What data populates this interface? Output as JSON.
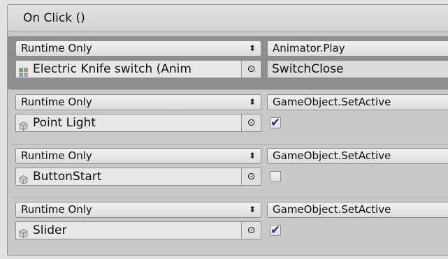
{
  "header": {
    "title": "On Click ()"
  },
  "entries": [
    {
      "call_state": "Runtime Only",
      "function": "Animator.Play",
      "target": "Electric Knife switch (Anim",
      "target_icon": "animator-component-icon",
      "argument_type": "string",
      "argument": "SwitchClose",
      "selected": true
    },
    {
      "call_state": "Runtime Only",
      "function": "GameObject.SetActive",
      "target": "Point Light",
      "target_icon": "gameobject-cube-icon",
      "argument_type": "bool",
      "argument": true
    },
    {
      "call_state": "Runtime Only",
      "function": "GameObject.SetActive",
      "target": "ButtonStart",
      "target_icon": "gameobject-cube-icon",
      "argument_type": "bool",
      "argument": false
    },
    {
      "call_state": "Runtime Only",
      "function": "GameObject.SetActive",
      "target": "Slider",
      "target_icon": "gameobject-cube-icon",
      "argument_type": "bool",
      "argument": true
    }
  ],
  "icons": {
    "dropdown": "updown-arrow-icon",
    "picker": "object-picker-icon"
  },
  "colors": {
    "checkmark": "#1b3a86",
    "selected_row": "#8e8e8e",
    "panel_bg": "#c9c9c9"
  }
}
